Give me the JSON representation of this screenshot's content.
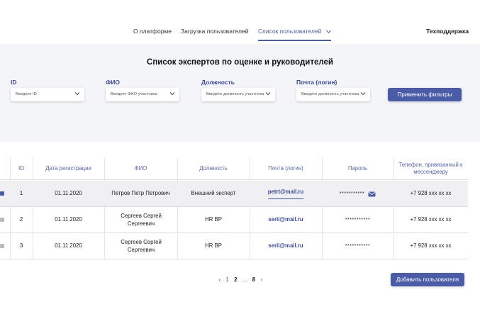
{
  "nav": {
    "about": "О платформе",
    "upload": "Загрузка пользователей",
    "list": "Список пользователей",
    "support": "Техподдержка"
  },
  "filters": {
    "title": "Список экспертов по оценке и руководителей",
    "id_label": "ID",
    "id_placeholder": "Введите ID",
    "fio_label": "ФИО",
    "fio_placeholder": "Введите ФИО участника",
    "position_label": "Должность",
    "position_placeholder": "Введите должность участника",
    "email_label": "Почта (логин)",
    "email_placeholder": "Введите должность участника",
    "apply": "Применить фильтры"
  },
  "table": {
    "headers": [
      "ID",
      "Дата регистрации",
      "ФИО",
      "Должность",
      "Почта (логин)",
      "Пароль",
      "Телефон, привязанный к мессенджеру"
    ],
    "rows": [
      {
        "checked": true,
        "id": "1",
        "date": "01.11.2020",
        "fio": "Петров Петр Петрович",
        "position": "Внешний эксперт",
        "email": "petrt@mail.ru",
        "password": "***********",
        "phone": "+7 928 xxx xx xx"
      },
      {
        "checked": false,
        "id": "2",
        "date": "01.11.2020",
        "fio": "Сергеев Сергей Сергеевич",
        "position": "HR BP",
        "email": "serii@mail.ru",
        "password": "***********",
        "phone": "+7 928 xxx xx xx"
      },
      {
        "checked": false,
        "id": "3",
        "date": "01.11.2020",
        "fio": "Сергеев Сергей Сергеевич",
        "position": "HR BP",
        "email": "serii@mail.ru",
        "password": "***********",
        "phone": "+7 928 xxx xx xx"
      }
    ]
  },
  "pagination": {
    "prev": "‹",
    "pages": [
      "1",
      "2",
      "...",
      "8"
    ],
    "current": "2",
    "next": "›"
  },
  "add_user": "Добавить пользователя",
  "colors": {
    "accent": "#4a5ba8",
    "panel": "#f4f5f8"
  }
}
